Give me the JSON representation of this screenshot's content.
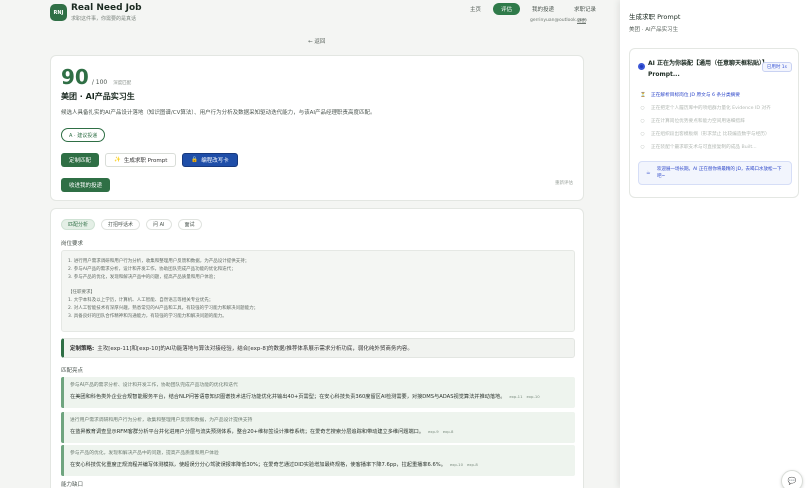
{
  "header": {
    "logo_text": "RNJ",
    "title": "Real Need Job",
    "subtitle": "求职这件事，你需要的是真话",
    "nav": [
      {
        "label": "主页",
        "active": false
      },
      {
        "label": "评估",
        "active": true
      },
      {
        "label": "我的投递",
        "active": false
      },
      {
        "label": "求职记录",
        "active": false
      }
    ],
    "user_email": "gerrinyuan@outlook.com",
    "logout_label": "退出"
  },
  "back_link": "← 返回",
  "evaluation": {
    "score": "90",
    "score_total": "/ 100",
    "score_label": "深度匹配",
    "job_title": "美团 · AI产品实习生",
    "summary": "候选人具备扎实的AI产品设计落地（知识图谱/CV算法）、用户行为分析及数据采知驱动迭代能力，与该AI产品经理职责高度匹配。",
    "suggest_button": "A · 建议投递",
    "buttons": {
      "custom_match": "定制匹配",
      "generate_prompt": "生成求职 Prompt",
      "custom_resume": "编程改写卡"
    },
    "collect_button": "收进我的投递",
    "corner_link": "重新评估"
  },
  "analysis": {
    "tabs": [
      {
        "label": "匹配分析",
        "active": true
      },
      {
        "label": "打招呼话术",
        "active": false
      },
      {
        "label": "问 AI",
        "active": false
      },
      {
        "label": "面试",
        "active": false
      }
    ],
    "jd_label": "岗位要求",
    "jd_lines": [
      "1. 进行用户需求调研和用户行为分析，收集和整理用户反馈和数据，为产品设计提供支持；",
      "2. 参与AI产品的需求分析，设计和开发工作，协助团队完成产品功能的优化和迭代；",
      "3. 参与产品的优化，发现和解决产品中的问题，提高产品质量和用户体验；",
      "",
      "【任职要求】",
      "1. 大学本科及以上学历，计算机、人工智能、自然语言等相关专业优先；",
      "2. 对人工智能技术有深厚兴趣，熟悉常见的AI产品和工具，有较强的学习能力和解决问题能力；",
      "3. 具备良好的团队合作精神和沟通能力，有较强的学习能力和解决问题的能力。"
    ],
    "custom_label": "定制策略:",
    "custom_text": "主攻[exp-11]和[exp-10]的AI功能落地与算法对接经验，结合[exp-8]的数据/推荐体系展示需求分析功底，弱化纯外贸商务内容。",
    "highlights_label": "匹配亮点",
    "highlights": [
      {
        "title": "参与AI产品的需求分析、设计和开发工作，协助团队完成产品功能的优化和迭代",
        "text": "在美团和科色类外企业合规智能服务平台，结合NLP问答语意知识图谱技术进行功能优化并输出40+页需型；在安心科技负责360度留区AI检测需要，对接DMS与ADAS视觉算法并推动落地。",
        "tags": [
          "exp-11",
          "exp-10"
        ]
      },
      {
        "title": "进行用户需求调研和用户行为分析，收集和整理用户反馈和数据，为产品设计提供支持",
        "text": "在蓝昇教育调查显示RFM客群分析平台并化进用户分层与流失预测体系，整合20+维标签设计推荐系统；在爱奇艺搜索分层追踪和带动建立多维问题端口。",
        "tags": [
          "exp-9",
          "exp-8"
        ]
      },
      {
        "title": "参与产品的优化，发现和解决产品中的问题，提高产品质量和用户体验",
        "text": "在安心科技优化重度正规流程并编写体测模拟，使超误分分心驾驶误报率降低30%；在爱奇艺通过DID实验增加最终规格，使客播率下降7.6pp，拉起重播率6.6%。",
        "tags": [
          "exp-10",
          "exp-8"
        ]
      }
    ],
    "ability_label": "能力缺口"
  },
  "panel": {
    "title": "生成求职 Prompt",
    "subtitle": "美团 · AI产品实习生",
    "status_title": "AI 正在为你装配【通用（任意聊天框粘贴）】Prompt...",
    "status_badge": "已用时 1s",
    "steps": [
      {
        "label": "正在解析目标岗位 JD 原文与 6 条分类摘要",
        "active": true,
        "icon": "⏳"
      },
      {
        "label": "正在把定个人履历库中的项组群力量化 Evidence ID 对齐",
        "active": false,
        "icon": "○"
      },
      {
        "label": "正在计算岗位优势要点和能力空间用语细措辞",
        "active": false,
        "icon": "○"
      },
      {
        "label": "正在组织段出客模板纲（形求禁止 比较编造数字与经历）",
        "active": false,
        "icon": "○"
      },
      {
        "label": "正在装配个最求职支术与可直接复制的成品 Built...",
        "active": false,
        "icon": "○"
      }
    ],
    "info_text": "欢迎展一场长期。AI 正在替你将最精的 JD，去喝口水放松一下吧~",
    "float_icon": "chat-bubble-icon"
  },
  "colors": {
    "brand": "#2f6f45",
    "accent_blue": "#2a44c8",
    "panel_bg": "#ffffff"
  }
}
